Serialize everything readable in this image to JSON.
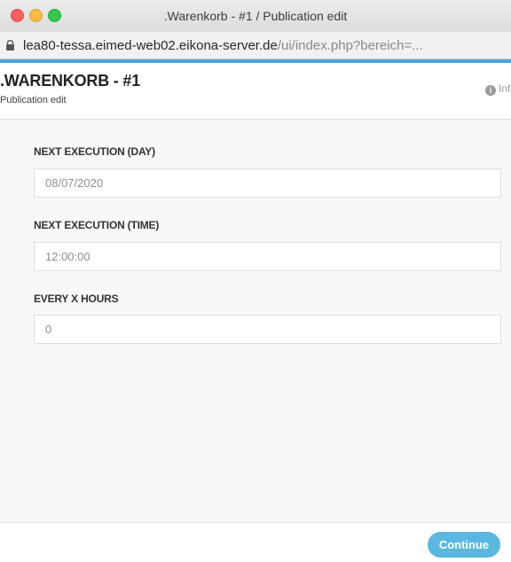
{
  "window": {
    "title": ".Warenkorb - #1 / Publication edit"
  },
  "addressbar": {
    "host": "lea80-tessa.eimed-web02.eikona-server.de",
    "path": "/ui/index.php?bereich=..."
  },
  "header": {
    "title": ".WARENKORB - #1",
    "subtitle": "Publication edit",
    "info_label": "Info"
  },
  "form": {
    "fields": [
      {
        "label": "NEXT EXECUTION (DAY)",
        "value": "08/07/2020"
      },
      {
        "label": "NEXT EXECUTION (TIME)",
        "value": "12:00:00"
      },
      {
        "label": "EVERY X HOURS",
        "value": "0"
      }
    ]
  },
  "footer": {
    "continue_label": "Continue"
  },
  "colors": {
    "accent": "#4aa3df",
    "button": "#5ab8e0"
  },
  "icons": [
    "lock-icon",
    "info-icon"
  ]
}
